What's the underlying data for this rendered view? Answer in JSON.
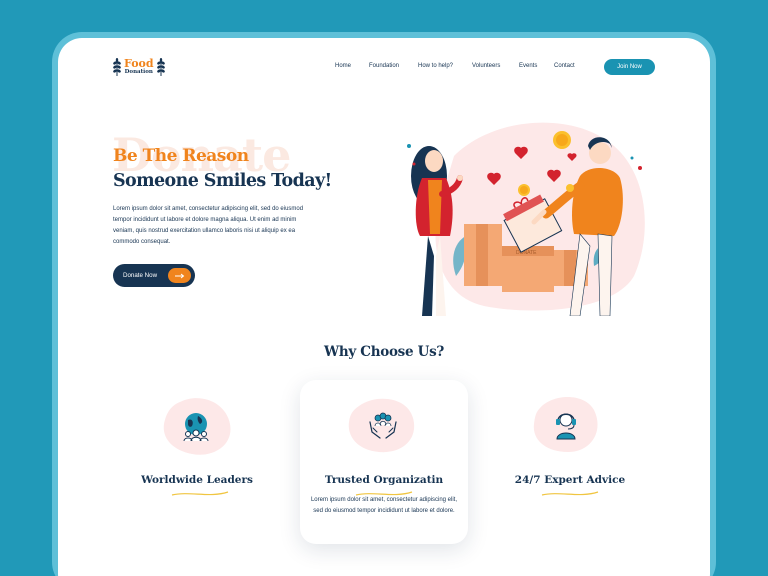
{
  "logo": {
    "title": "Food",
    "subtitle": "Donation"
  },
  "nav": {
    "items": [
      {
        "label": "Home"
      },
      {
        "label": "Foundation"
      },
      {
        "label": "How to help?"
      },
      {
        "label": "Volunteers"
      },
      {
        "label": "Events"
      },
      {
        "label": "Contact"
      }
    ],
    "cta": "Join Now"
  },
  "hero": {
    "watermark": "Donate",
    "line1": "Be The Reason",
    "line2": "Someone Smiles Today!",
    "description": "Lorem ipsum dolor sit amet, consectetur adipiscing elit, sed do eiusmod tempor incididunt ut labore et dolore magna aliqua. Ut enim ad minim veniam, quis nostrud exercitation ullamco laboris nisi ut aliquip ex ea commodo consequat.",
    "button": "Donate Now",
    "button_icon": "arrow-right-icon",
    "box_label": "DONATE"
  },
  "why": {
    "title": "Why Choose Us?",
    "features": [
      {
        "icon": "globe-people-icon",
        "title": "Worldwide Leaders"
      },
      {
        "icon": "hands-people-icon",
        "title": "Trusted Organizatin",
        "description": "Lorem ipsum dolor sit amet, consectetur adipiscing elit, sed do eiusmod tempor incididunt ut labore et dolore."
      },
      {
        "icon": "headset-support-icon",
        "title": "24/7 Expert Advice"
      }
    ]
  },
  "colors": {
    "background": "#2199b8",
    "accent": "#f0841d",
    "navy": "#173452",
    "button": "#1a93b2",
    "blob": "#fde8e8"
  }
}
